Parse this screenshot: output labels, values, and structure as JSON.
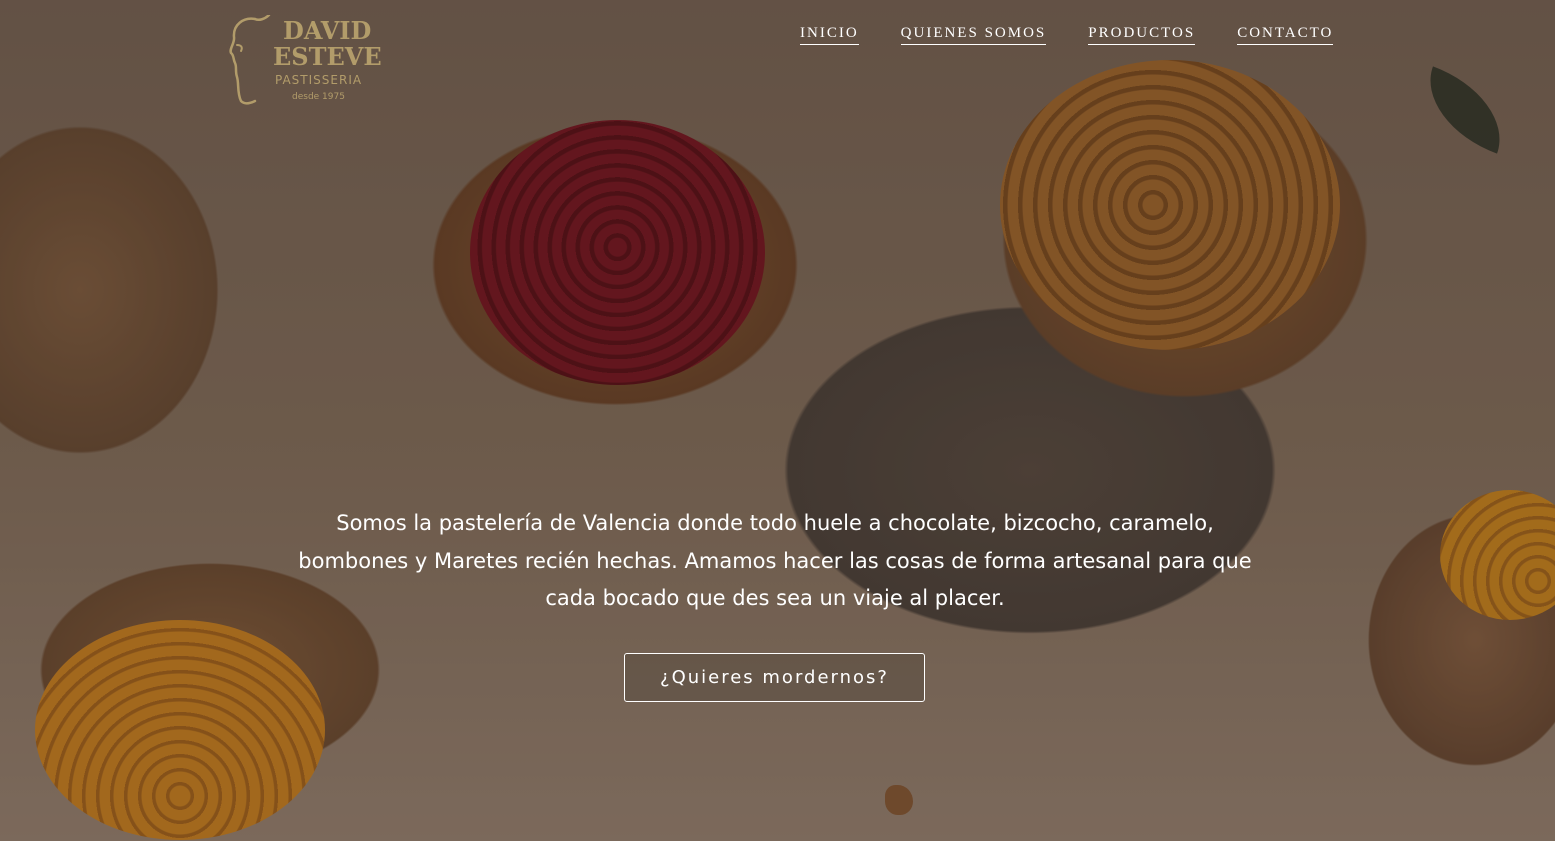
{
  "brand": {
    "name_line1": "DAVID",
    "name_line2": "ESTEVE",
    "subtitle": "PASTISSERIA",
    "since": "desde 1975",
    "color": "#b29c6a"
  },
  "nav": {
    "items": [
      {
        "label": "INICIO"
      },
      {
        "label": "QUIENES SOMOS"
      },
      {
        "label": "PRODUCTOS"
      },
      {
        "label": "CONTACTO"
      }
    ]
  },
  "hero": {
    "tagline": "Somos la pastelería de Valencia donde todo huele a chocolate, bizcocho, caramelo, bombones y Maretes recién hechas. Amamos hacer las cosas de forma artesanal para que cada bocado que des sea un viaje al placer.",
    "cta_label": "¿Quieres mordernos?"
  },
  "icons": {
    "logo": "profile-face-logo-icon"
  },
  "colors": {
    "text": "#ffffff",
    "logo_gold": "#b29c6a"
  }
}
